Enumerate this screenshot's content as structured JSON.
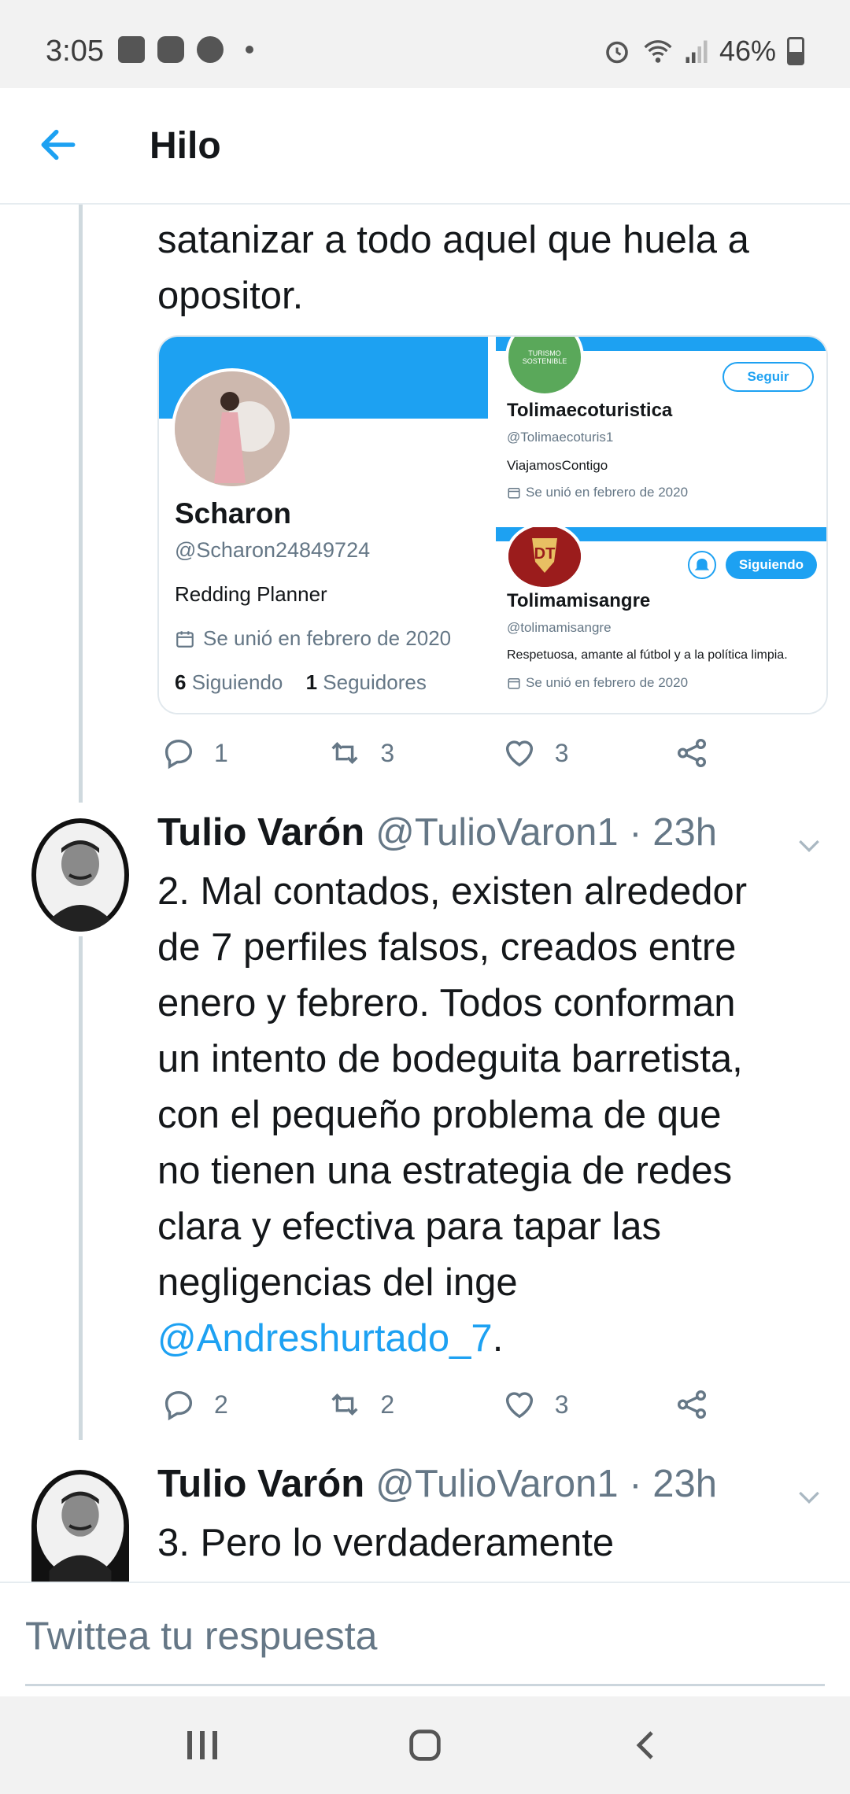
{
  "status_bar": {
    "time": "3:05",
    "battery": "46%",
    "icons_left": [
      "gallery-icon",
      "youtube-icon",
      "facebook-icon",
      "dot-icon"
    ],
    "icons_right": [
      "alarm-icon",
      "wifi-icon",
      "signal-icon",
      "battery-icon"
    ]
  },
  "header": {
    "title": "Hilo",
    "back_icon": "arrow-left-icon"
  },
  "tweet1": {
    "text_line1": "satanizar a todo aquel que huela a",
    "text_line2": "opositor.",
    "media": {
      "main": {
        "name": "Scharon",
        "handle": "@Scharon24849724",
        "bio": "Redding Planner",
        "joined": "Se unió en febrero de 2020",
        "following_count": "6",
        "following_label": "Siguiendo",
        "followers_count": "1",
        "followers_label": "Seguidores"
      },
      "card2": {
        "name": "Tolimaecoturistica",
        "handle": "@Tolimaecoturis1",
        "bio": "ViajamosContigo",
        "joined": "Se unió en febrero de 2020",
        "button": "Seguir",
        "avatar_text": "TURISMO SOSTENIBLE"
      },
      "card3": {
        "name": "Tolimamisangre",
        "handle": "@tolimamisangre",
        "bio": "Respetuosa, amante al fútbol y a la política limpia.",
        "joined": "Se unió en febrero de 2020",
        "button": "Siguiendo"
      }
    },
    "actions": {
      "replies": "1",
      "retweets": "3",
      "likes": "3"
    }
  },
  "tweet2": {
    "name": "Tulio Varón",
    "handle": "@TulioVaron1 · 23h",
    "lines": [
      "2. Mal contados, existen alrededor",
      "de 7 perfiles falsos, creados entre",
      "enero y febrero. Todos conforman",
      "un intento de bodeguita barretista,",
      "con el pequeño problema de que",
      "no tienen una estrategia de redes",
      "clara y efectiva para tapar las",
      "negligencias del inge"
    ],
    "mention": "@Andreshurtado_7",
    "mention_suffix": ".",
    "actions": {
      "replies": "2",
      "retweets": "2",
      "likes": "3"
    }
  },
  "tweet3": {
    "name": "Tulio Varón",
    "handle": "@TulioVaron1 · 23h",
    "line1": "3. Pero lo verdaderamente"
  },
  "reply": {
    "placeholder": "Twittea tu respuesta"
  },
  "colors": {
    "accent": "#1da1f2",
    "text": "#14171a",
    "muted": "#657786"
  }
}
